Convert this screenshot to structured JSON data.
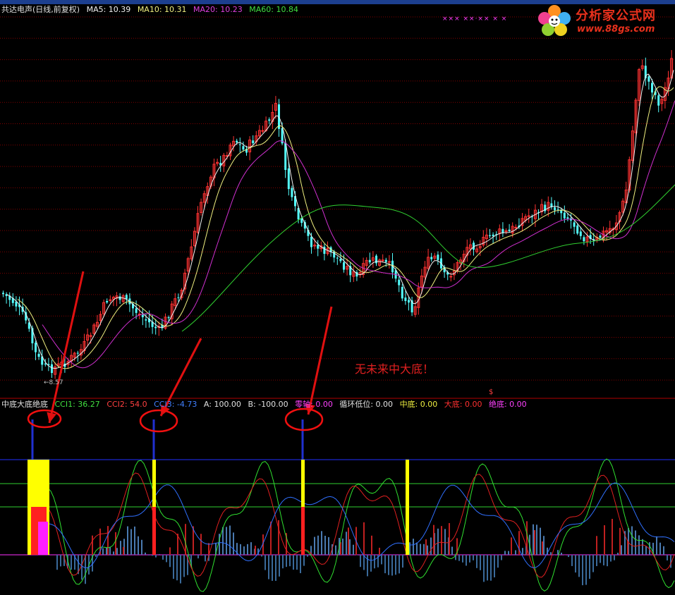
{
  "price_legend": [
    {
      "text": "共达电声(日线,前复权)",
      "color": "#e0e0e0"
    },
    {
      "text": "MA5: 10.39",
      "color": "#f0f0f0"
    },
    {
      "text": "MA10: 10.31",
      "color": "#f0f080"
    },
    {
      "text": "MA20: 10.23",
      "color": "#e040e0"
    },
    {
      "text": "MA60: 10.84",
      "color": "#40e040"
    }
  ],
  "indicator_legend": [
    {
      "text": "中底大底绝底",
      "color": "#e0e0e0"
    },
    {
      "text": "CCI1: 36.27",
      "color": "#40e040"
    },
    {
      "text": "CCI2: 54.0",
      "color": "#ff4040"
    },
    {
      "text": "CCI3: -4.73",
      "color": "#4080ff"
    },
    {
      "text": "A: 100.00",
      "color": "#e0e0e0"
    },
    {
      "text": "B: -100.00",
      "color": "#e0e0e0"
    },
    {
      "text": "零轴: 0.00",
      "color": "#ff40ff"
    },
    {
      "text": "循环低位: 0.00",
      "color": "#e0e0e0"
    },
    {
      "text": "中底: 0.00",
      "color": "#f0f040"
    },
    {
      "text": "大底: 0.00",
      "color": "#ff3030"
    },
    {
      "text": "绝底: 0.00",
      "color": "#ff40ff"
    }
  ],
  "annotation": "无未来中大底！",
  "low_marker": "←8.57",
  "dollar_marker": "$",
  "x_marks": "××× ××·×× × ×",
  "logo": {
    "title": "分析家公式网",
    "url": "www.88gs.com"
  },
  "colors": {
    "up": "#ff3232",
    "down": "#54ffff",
    "ma5": "#f0f0f0",
    "ma10": "#f0f080",
    "ma20": "#d030d0",
    "ma60": "#30d030",
    "grid": "#800000",
    "blue_line": "#2030d0",
    "yellow": "#ffff00",
    "red": "#ff2020",
    "magenta": "#ff20ff"
  },
  "icons": [
    "arrow-icon",
    "circle-highlight",
    "flower-logo-icon"
  ]
}
